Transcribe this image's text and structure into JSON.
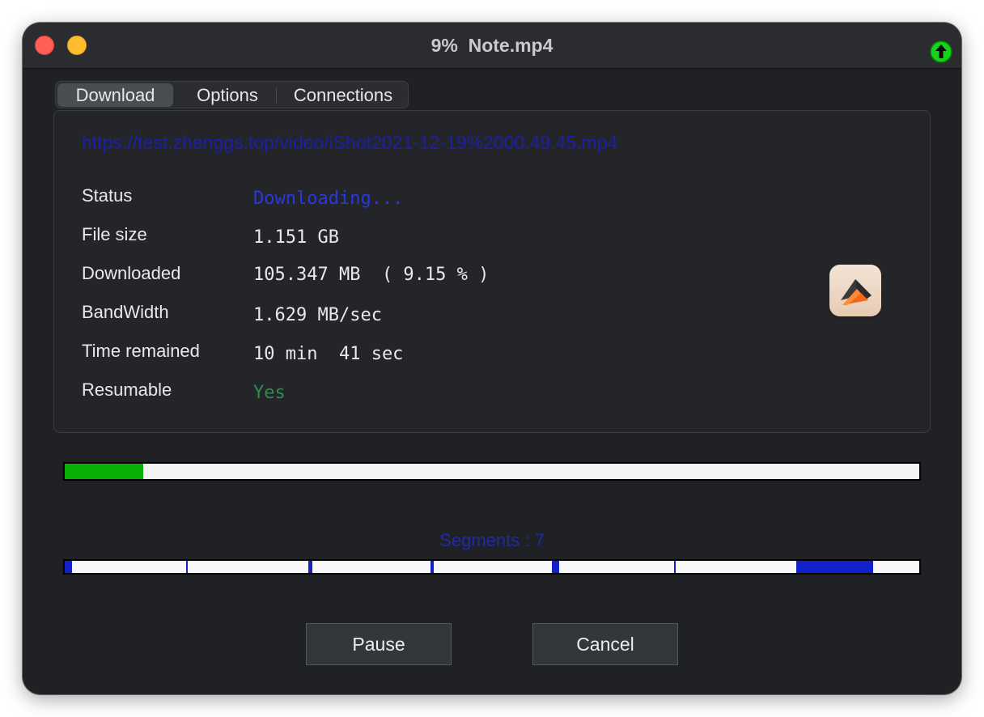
{
  "window": {
    "title": "9%  Note.mp4"
  },
  "tabs": [
    {
      "label": "Download",
      "active": true
    },
    {
      "label": "Options",
      "active": false
    },
    {
      "label": "Connections",
      "active": false
    }
  ],
  "download": {
    "url": "https://test.zhenggs.top/video/iShot2021-12-19%2000.49.45.mp4",
    "fields": [
      {
        "label": "Status",
        "value": "Downloading..."
      },
      {
        "label": "File size",
        "value": "1.151 GB"
      },
      {
        "label": "Downloaded",
        "value": "105.347 MB  ( 9.15 % )"
      },
      {
        "label": "BandWidth",
        "value": "1.629 MB/sec"
      },
      {
        "label": "Time remained",
        "value": "10 min  41 sec"
      },
      {
        "label": "Resumable",
        "value": "Yes"
      }
    ]
  },
  "progress": {
    "fraction": 0.0915,
    "color": "#09b006"
  },
  "segments": {
    "label": "Segments : 7",
    "count": 7,
    "color": "#1321c9"
  },
  "buttons": {
    "pause": "Pause",
    "cancel": "Cancel"
  },
  "icons": {
    "status_indicator": "green-upload-arrow-icon",
    "app_logo": "orange-chevron-app-icon"
  },
  "colors": {
    "url": "#1c1fa8",
    "status_value": "#2a38e0",
    "resumable_value": "#2f8f4a"
  }
}
